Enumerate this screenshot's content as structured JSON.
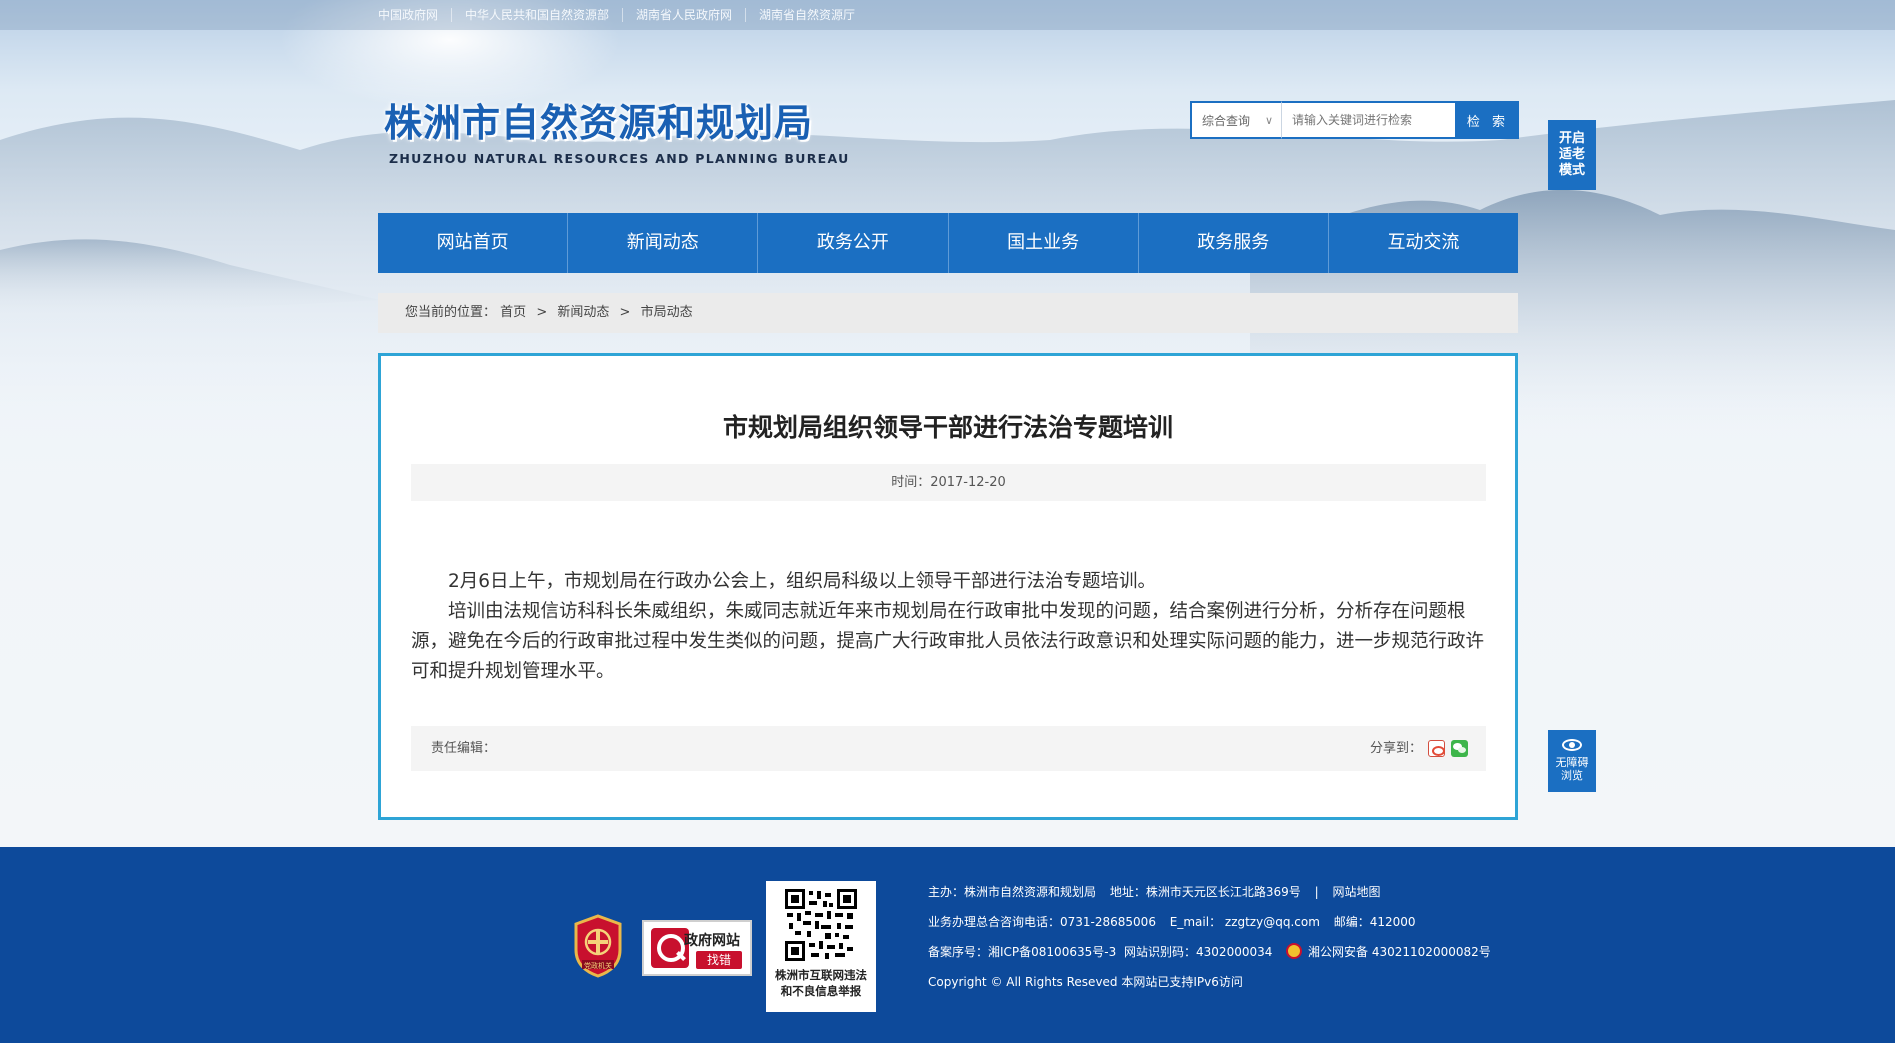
{
  "topbar": {
    "links": [
      "中国政府网",
      "中华人民共和国自然资源部",
      "湖南省人民政府网",
      "湖南省自然资源厅"
    ]
  },
  "logo": {
    "title_cn": "株洲市自然资源和规划局",
    "title_en": "ZHUZHOU NATURAL RESOURCES AND PLANNING BUREAU"
  },
  "search": {
    "scope": "综合查询",
    "placeholder": "请输入关键词进行检索",
    "button": "检 索"
  },
  "side": {
    "elder_mode": [
      "开启",
      "适老",
      "模式"
    ],
    "accessible": [
      "无障碍",
      "浏览"
    ]
  },
  "nav": {
    "items": [
      "网站首页",
      "新闻动态",
      "政务公开",
      "国土业务",
      "政务服务",
      "互动交流"
    ]
  },
  "breadcrumb": {
    "prefix": "您当前的位置：",
    "items": [
      "首页",
      "新闻动态",
      "市局动态"
    ],
    "separator": ">"
  },
  "article": {
    "title": "市规划局组织领导干部进行法治专题培训",
    "time_label": "时间：2017-12-20",
    "paragraphs": [
      "2月6日上午，市规划局在行政办公会上，组织局科级以上领导干部进行法治专题培训。",
      "培训由法规信访科科长朱威组织，朱威同志就近年来市规划局在行政审批中发现的问题，结合案例进行分析，分析存在问题根源，避免在今后的行政审批过程中发生类似的问题，提高广大行政审批人员依法行政意识和处理实际问题的能力，进一步规范行政许可和提升规划管理水平。"
    ],
    "editor_label": "责任编辑：",
    "share_label": "分享到：",
    "share_icons": [
      "weibo-icon",
      "wechat-icon"
    ]
  },
  "footer": {
    "badge_text": "党政机关",
    "findbug_title": "政府网站",
    "findbug_action": "找错",
    "qr_caption": [
      "株洲市互联网违法",
      "和不良信息举报"
    ],
    "host": "主办：株洲市自然资源和规划局",
    "address": "地址：株洲市天元区长江北路369号",
    "sitemap": "网站地图",
    "phone": "业务办理总合咨询电话：0731-28685006",
    "email": "E_mail： zzgtzy@qq.com",
    "postcode": "邮编：412000",
    "icp": "备案序号：湘ICP备08100635号-3",
    "site_id": "网站识别码：4302000034",
    "police": "湘公网安备 43021102000082号",
    "copyright": "Copyright © All Rights Reseved 本网站已支持IPv6访问"
  },
  "colors": {
    "brand_blue": "#1b6fc2",
    "footer_blue": "#0d4a9b",
    "article_border": "#2ea4d6"
  }
}
